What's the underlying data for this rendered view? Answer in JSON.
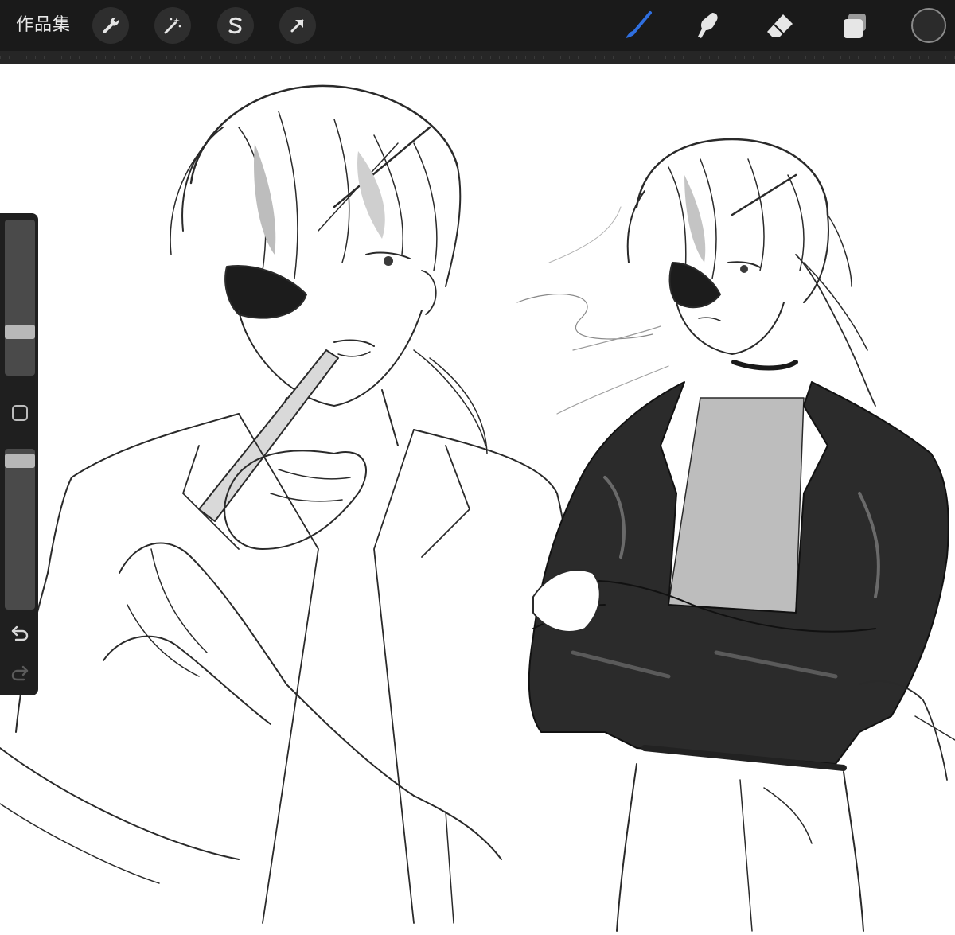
{
  "app": {
    "gallery_label": "作品集"
  },
  "toolbar": {
    "left_tools": [
      {
        "name": "wrench-icon",
        "action": "actions"
      },
      {
        "name": "magic-wand-icon",
        "action": "adjustments"
      },
      {
        "name": "selection-s-icon",
        "action": "selection"
      },
      {
        "name": "arrow-cursor-icon",
        "action": "transform"
      }
    ],
    "right_tools": [
      {
        "name": "brush-icon",
        "action": "paint",
        "active": true
      },
      {
        "name": "smudge-icon",
        "action": "smudge"
      },
      {
        "name": "eraser-icon",
        "action": "erase"
      },
      {
        "name": "layers-icon",
        "action": "layers"
      }
    ],
    "active_color": "#2b2b2b",
    "accent_color": "#2f6fe0"
  },
  "sidebar": {
    "brush_size_level": 0.4,
    "opacity_level": 0.97,
    "modifier_button": "square-icon",
    "undo": "undo-icon",
    "redo": "redo-icon"
  }
}
